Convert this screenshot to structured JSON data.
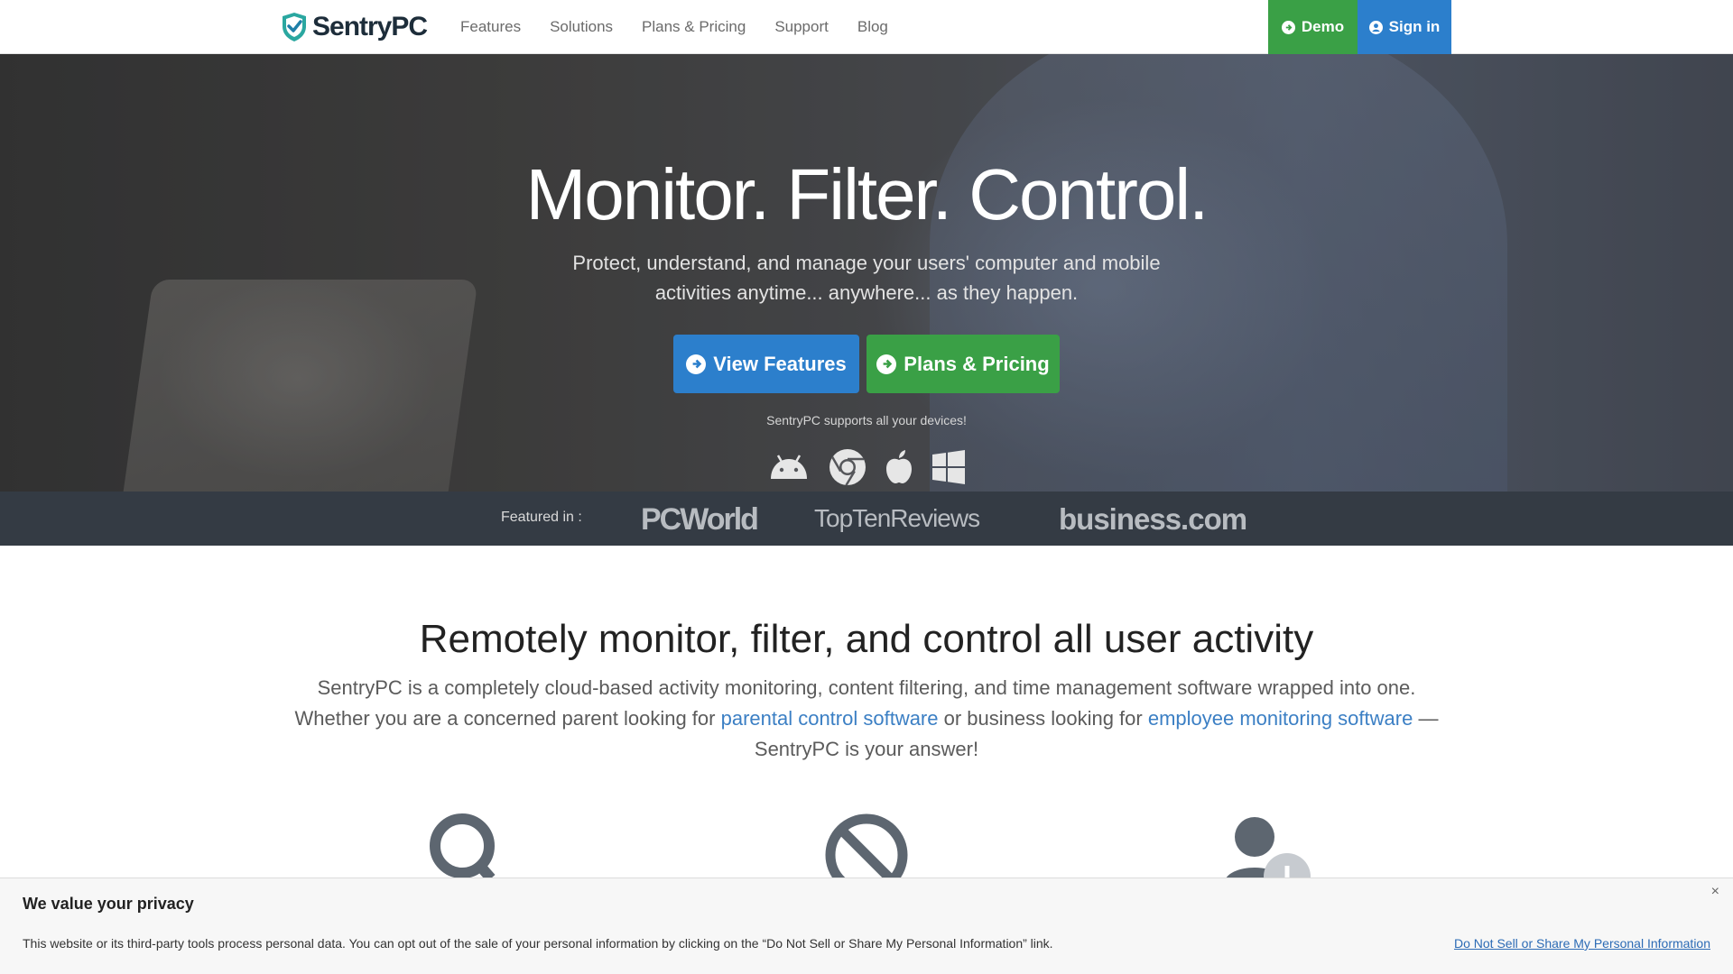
{
  "header": {
    "logo_text": "SentryPC",
    "nav": [
      "Features",
      "Solutions",
      "Plans & Pricing",
      "Support",
      "Blog"
    ],
    "demo_label": "Demo",
    "signin_label": "Sign in"
  },
  "hero": {
    "title": "Monitor. Filter. Control.",
    "subtitle_line1": "Protect, understand, and manage your users' computer and mobile",
    "subtitle_line2": "activities anytime... anywhere... as they happen.",
    "view_features": "View Features",
    "plans_pricing": "Plans & Pricing",
    "supports": "SentryPC supports all your devices!",
    "device_icons": [
      "android-icon",
      "chrome-icon",
      "apple-icon",
      "windows-icon"
    ]
  },
  "featured": {
    "label": "Featured in :",
    "brands": [
      "PCWorld",
      "TopTenReviews",
      "business.com"
    ]
  },
  "main": {
    "title": "Remotely monitor, filter, and control all user activity",
    "para_1": "SentryPC is a completely cloud-based activity monitoring, content filtering, and time management software wrapped into one. Whether you are a concerned parent looking for ",
    "link_1": "parental control software",
    "para_2": " or business looking for ",
    "link_2": "employee monitoring software",
    "para_3": " — SentryPC is your answer!",
    "feature_icons": [
      "magnifier-icon",
      "block-icon",
      "user-time-icon"
    ]
  },
  "privacy": {
    "title": "We value your privacy",
    "text": "This website or its third-party tools process personal data. You can opt out of the sale of your personal information by clicking on the “Do Not Sell or Share My Personal Information” link.",
    "link": "Do Not Sell or Share My Personal Information",
    "close": "×"
  },
  "colors": {
    "green": "#3aa046",
    "blue": "#2c7fcc",
    "dark_strip": "#343b44",
    "link": "#3b7fc4"
  }
}
